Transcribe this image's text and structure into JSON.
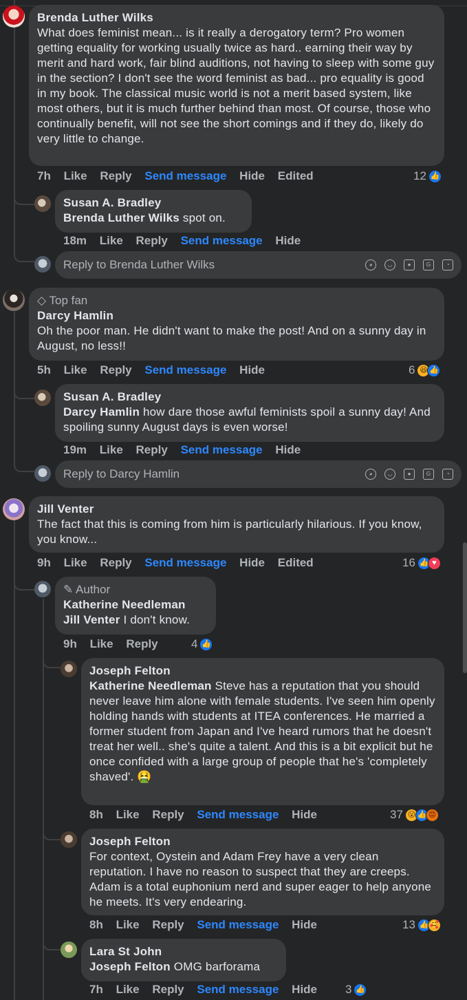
{
  "comments": {
    "brenda": {
      "name": "Brenda Luther Wilks",
      "text": "What does feminist mean... is it really a derogatory term? Pro women getting equality for working usually twice as hard.. earning their way by merit and hard work, fair blind auditions, not having to sleep with some guy in the section? I don't see the word feminist as bad... pro equality is good in my book. The classical music world is not a merit based system, like most others, but it is much further behind than most. Of course, those who continually benefit, will not see the short comings and if they do, likely do very little to change.",
      "time": "7h",
      "like": "Like",
      "reply": "Reply",
      "send": "Send message",
      "hide": "Hide",
      "edited": "Edited",
      "reactions": "12"
    },
    "susan1": {
      "name": "Susan A. Bradley",
      "mention": "Brenda Luther Wilks",
      "text": "spot on.",
      "time": "18m",
      "like": "Like",
      "reply": "Reply",
      "send": "Send message",
      "hide": "Hide"
    },
    "reply_box_1": {
      "placeholder": "Reply to Brenda Luther Wilks"
    },
    "darcy": {
      "badge": "Top fan",
      "name": "Darcy Hamlin",
      "text": "Oh the poor man. He didn't want to make the post! And on a sunny day in August, no less!!",
      "time": "5h",
      "like": "Like",
      "reply": "Reply",
      "send": "Send message",
      "hide": "Hide",
      "reactions": "6"
    },
    "susan2": {
      "name": "Susan A. Bradley",
      "mention": "Darcy Hamlin",
      "text": "how dare those awful feminists spoil a sunny day! And spoiling sunny August days is even worse!",
      "time": "19m",
      "like": "Like",
      "reply": "Reply",
      "send": "Send message",
      "hide": "Hide"
    },
    "reply_box_2": {
      "placeholder": "Reply to Darcy Hamlin"
    },
    "jill": {
      "name": "Jill Venter",
      "text": "The fact that this is coming from him is particularly hilarious. If you know, you know...",
      "time": "9h",
      "like": "Like",
      "reply": "Reply",
      "send": "Send message",
      "hide": "Hide",
      "edited": "Edited",
      "reactions": "16"
    },
    "katherine": {
      "badge": "Author",
      "name": "Katherine Needleman",
      "mention": "Jill Venter",
      "text": "I don't know.",
      "time": "9h",
      "like": "Like",
      "reply": "Reply",
      "reactions": "4"
    },
    "joseph1": {
      "name": "Joseph Felton",
      "mention": "Katherine Needleman",
      "text": "Steve has a reputation that you should never leave him alone with female students. I've seen him openly holding hands with students at ITEA conferences. He married a former student from Japan and I've heard rumors that he doesn't treat her well.. she's quite a talent. And this is a bit explicit but he once confided with a large group of people that he's 'completely shaved'.",
      "emoji": "🤮",
      "time": "8h",
      "like": "Like",
      "reply": "Reply",
      "send": "Send message",
      "hide": "Hide",
      "reactions": "37"
    },
    "joseph2": {
      "name": "Joseph Felton",
      "text": "For context, Oystein and Adam Frey have a very clean reputation. I have no reason to suspect that they are creeps. Adam is a total euphonium nerd and super eager to help anyone he meets. It's very endearing.",
      "time": "8h",
      "like": "Like",
      "reply": "Reply",
      "send": "Send message",
      "hide": "Hide",
      "reactions": "13"
    },
    "lara": {
      "name": "Lara St John",
      "mention": "Joseph Felton",
      "text": "OMG barforama",
      "time": "7h",
      "like": "Like",
      "reply": "Reply",
      "send": "Send message",
      "hide": "Hide",
      "reactions": "3"
    }
  },
  "icons": [
    "like-icon",
    "love-icon",
    "haha-icon",
    "wow-icon",
    "angry-icon",
    "care-icon",
    "sticker-icon",
    "emoji-icon",
    "camera-icon",
    "gif-icon",
    "avatar-sticker-icon"
  ],
  "colors": {
    "background": "#242526",
    "bubble": "#3a3b3c",
    "link": "#2d88ff",
    "muted": "#b0b3b8",
    "text": "#e4e6eb"
  }
}
